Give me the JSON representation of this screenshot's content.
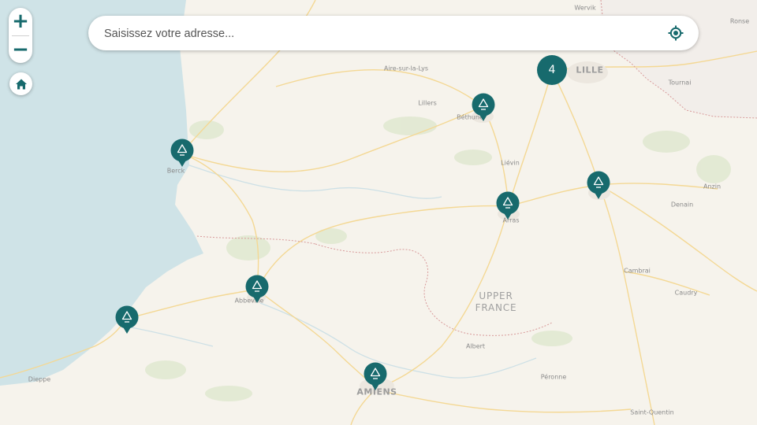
{
  "search": {
    "placeholder": "Saisissez votre adresse...",
    "value": ""
  },
  "controls": {
    "zoom_in": "+",
    "zoom_out": "−",
    "home_icon": "home-icon",
    "locate_icon": "locate-icon"
  },
  "colors": {
    "accent": "#176a6d",
    "sea": "#cfe3e7",
    "land": "#f6f3ec",
    "road": "#f7d98a",
    "border": "#d98a8a",
    "park": "#dfe8cf"
  },
  "places": [
    {
      "id": "wervik",
      "name": "Wervik"
    },
    {
      "id": "ronse",
      "name": "Ronse"
    },
    {
      "id": "aire",
      "name": "Aire-sur-la-Lys"
    },
    {
      "id": "lille",
      "name": "LILLE"
    },
    {
      "id": "tournai",
      "name": "Tournai"
    },
    {
      "id": "lillers",
      "name": "Lillers"
    },
    {
      "id": "bethune",
      "name": "Béthune"
    },
    {
      "id": "lievin",
      "name": "Liévin"
    },
    {
      "id": "berck",
      "name": "Berck"
    },
    {
      "id": "anzin",
      "name": "Anzin"
    },
    {
      "id": "denain",
      "name": "Denain"
    },
    {
      "id": "arras",
      "name": "Arras"
    },
    {
      "id": "cambrai",
      "name": "Cambrai"
    },
    {
      "id": "abbeville",
      "name": "Abbeville"
    },
    {
      "id": "region",
      "name": "UPPER FRANCE"
    },
    {
      "id": "caudry",
      "name": "Caudry"
    },
    {
      "id": "albert",
      "name": "Albert"
    },
    {
      "id": "dieppe",
      "name": "Dieppe"
    },
    {
      "id": "peronne",
      "name": "Péronne"
    },
    {
      "id": "amiens",
      "name": "AMIENS"
    },
    {
      "id": "stquentin",
      "name": "Saint-Quentin"
    }
  ],
  "markers": [
    {
      "id": "marker-bethune",
      "icon": "recycle-icon"
    },
    {
      "id": "marker-berck",
      "icon": "recycle-icon"
    },
    {
      "id": "marker-arras",
      "icon": "recycle-icon"
    },
    {
      "id": "marker-douai",
      "icon": "recycle-icon"
    },
    {
      "id": "marker-abbeville",
      "icon": "recycle-icon"
    },
    {
      "id": "marker-coast",
      "icon": "recycle-icon"
    },
    {
      "id": "marker-amiens",
      "icon": "recycle-icon"
    }
  ],
  "cluster": {
    "count": "4"
  }
}
